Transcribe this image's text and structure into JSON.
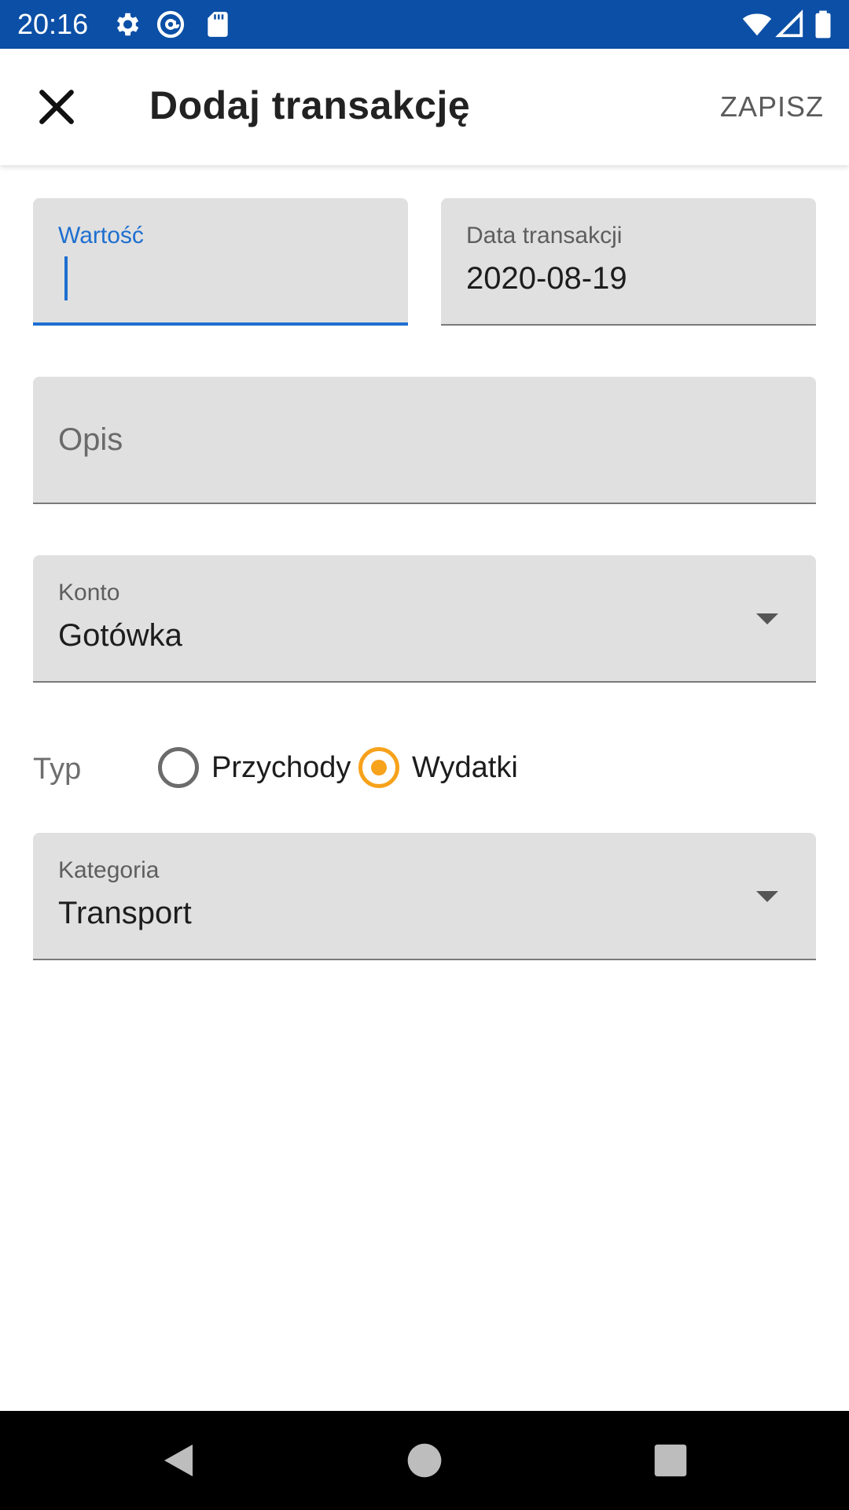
{
  "status_bar": {
    "time": "20:16",
    "icons_left": [
      "gear-icon",
      "at-sign-icon",
      "sd-card-icon"
    ],
    "icons_right": [
      "wifi-icon",
      "cellular-signal-icon",
      "battery-icon"
    ],
    "background_color": "#0b4fa6"
  },
  "app_bar": {
    "title": "Dodaj transakcję",
    "close_icon": "close-icon",
    "save_label": "ZAPISZ"
  },
  "form": {
    "amount": {
      "label": "Wartość",
      "value": ""
    },
    "date": {
      "label": "Data transakcji",
      "value": "2020-08-19"
    },
    "description": {
      "placeholder": "Opis",
      "value": ""
    },
    "account": {
      "label": "Konto",
      "value": "Gotówka"
    },
    "type": {
      "label": "Typ",
      "options": [
        {
          "label": "Przychody",
          "selected": false
        },
        {
          "label": "Wydatki",
          "selected": true
        }
      ]
    },
    "category": {
      "label": "Kategoria",
      "value": "Transport"
    }
  },
  "colors": {
    "focus": "#1e6fd0",
    "radio_selected": "#f7a21b",
    "field_background": "#e0e0e0"
  },
  "nav_bar": {
    "buttons": [
      "back-icon",
      "home-icon",
      "recents-icon"
    ]
  }
}
